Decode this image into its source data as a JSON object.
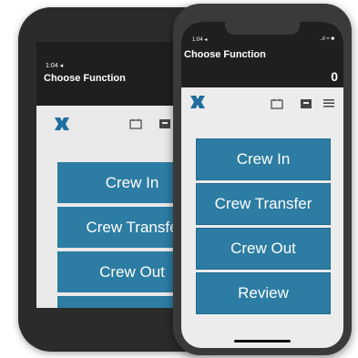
{
  "back_phone": {
    "time": "1:04 ◂",
    "title": "Choose Function",
    "buttons": [
      "Crew In",
      "Crew Transfe",
      "Crew Out"
    ]
  },
  "front_phone": {
    "time": "1:04 ◂",
    "signal": "..ıl ≈ ■",
    "title": "Choose Function",
    "count": "0",
    "buttons": [
      "Crew In",
      "Crew Transfer",
      "Crew Out",
      "Review"
    ]
  },
  "icons": {
    "logo": "app-logo-icon",
    "calendar": "calendar-icon",
    "archive": "archive-icon",
    "menu": "menu-icon"
  },
  "colors": {
    "header": "#1f1f1f",
    "button": "#2c7ca3",
    "screen_bg": "#ececec",
    "logo": "#1f6fa0"
  }
}
